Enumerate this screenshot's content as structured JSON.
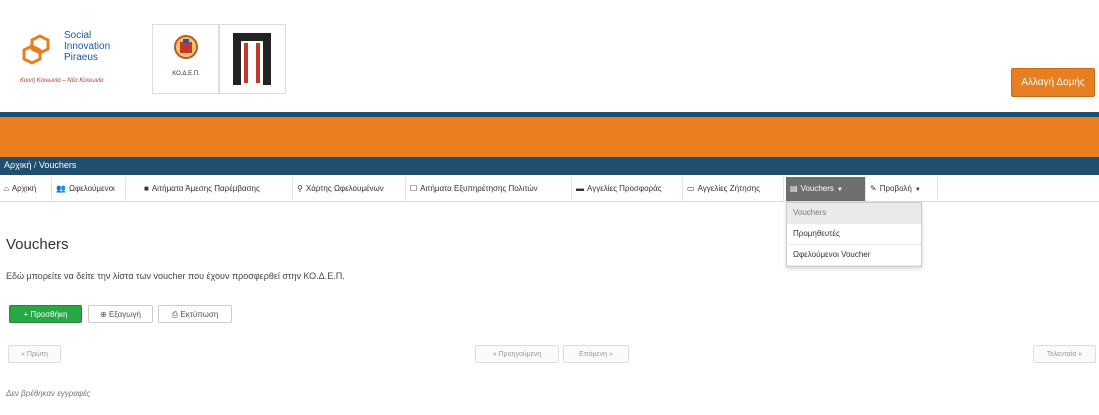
{
  "branding": {
    "logo1_text": [
      "Social",
      "Innovation",
      "Piraeus"
    ],
    "logo1_tagline": "Κοινή Κοινωνία – Νέα Κοινωνία",
    "logo2_caption": "ΚΟ.Δ.Ε.Π.",
    "accent_color": "#e87e1f",
    "navy_color": "#1f4e6e"
  },
  "header": {
    "switch_button": "Αλλαγή Δομής"
  },
  "breadcrumb": {
    "home": "Αρχική",
    "separator": "/",
    "current": "Vouchers"
  },
  "nav": {
    "items": [
      {
        "label": "Αρχική",
        "icon": "home-icon"
      },
      {
        "label": "Ωφελούμενοι",
        "icon": "users-icon"
      },
      {
        "label": "Αιτήματα Άμεσης Παρέμβασης",
        "icon": "file-icon"
      },
      {
        "label": "Χάρτης Ωφελουμένων",
        "icon": "map-marker-icon"
      },
      {
        "label": "Αιτήματα Εξυπηρέτησης Πολιτών",
        "icon": "document-icon"
      },
      {
        "label": "Αγγελίες Προσφοράς",
        "icon": "folder-icon"
      },
      {
        "label": "Αγγελίες Ζήτησης",
        "icon": "folder-open-icon"
      },
      {
        "label": "Vouchers",
        "icon": "ticket-icon"
      },
      {
        "label": "Προβολή",
        "icon": "edit-icon"
      }
    ],
    "dropdown": [
      "Vouchers",
      "Προμηθευτές",
      "Ωφελούμενοι Voucher"
    ]
  },
  "main": {
    "title": "Vouchers",
    "description": "Εδώ μπορείτε να δείτε την λίστα των voucher που έχουν προσφερθεί στην ΚΟ.Δ.Ε.Π.",
    "add_button": "+ Προσθήκη",
    "export_button": "Εξαγωγή",
    "print_button": "Εκτύπωση",
    "pagination": {
      "first": "« Πρώτη",
      "prev": "« Προηγούμενη",
      "next": "Επόμενη »",
      "last": "Τελευταία »"
    },
    "no_records": "Δεν βρέθηκαν εγγραφές"
  }
}
